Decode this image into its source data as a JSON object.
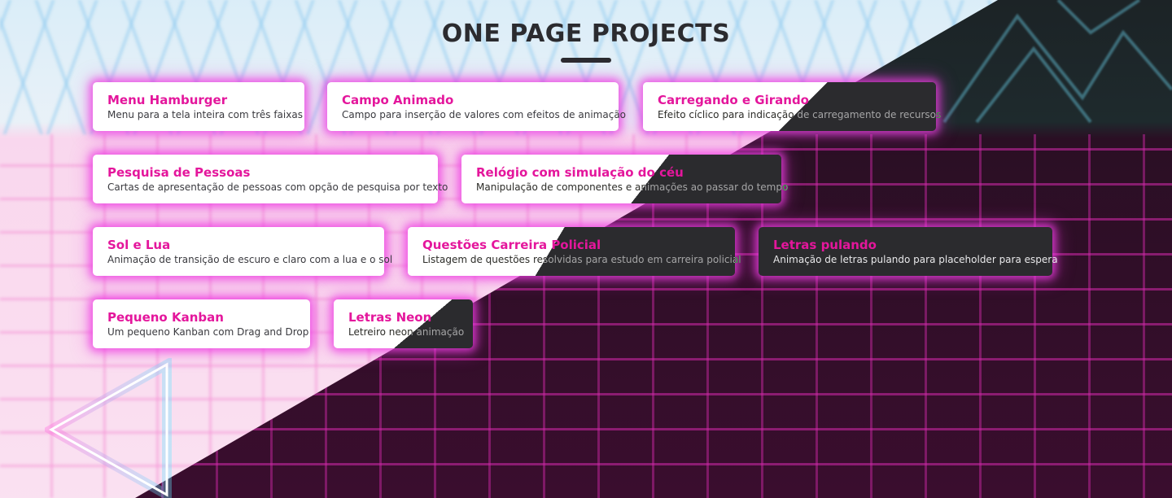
{
  "page": {
    "title": "ONE PAGE PROJECTS"
  },
  "colors": {
    "accent": "#e4169c",
    "glow": "#ee3ce1",
    "dark_card": "#2b2b2e",
    "light_card": "#ffffff",
    "title_text": "#2b2b2f"
  },
  "projects": [
    {
      "title": "Menu Hamburger",
      "description": "Menu para a tela inteira com três faixas"
    },
    {
      "title": "Campo Animado",
      "description": "Campo para inserção de valores com efeitos de animação"
    },
    {
      "title": "Carregando e Girando",
      "description": "Efeito cíclico para indicação de carregamento de recursos"
    },
    {
      "title": "Pesquisa de Pessoas",
      "description": "Cartas de apresentação de pessoas com opção de pesquisa por texto"
    },
    {
      "title": "Relógio com simulação do céu",
      "description": "Manipulação de componentes e animações ao passar do tempo"
    },
    {
      "title": "Sol e Lua",
      "description": "Animação de transição de escuro e claro com a lua e o sol"
    },
    {
      "title": "Questões Carreira Policial",
      "description": "Listagem de questões resolvidas para estudo em carreira policial"
    },
    {
      "title": "Letras pulando",
      "description": "Animação de letras pulando para placeholder para espera"
    },
    {
      "title": "Pequeno Kanban",
      "description": "Um pequeno Kanban com Drag and Drop"
    },
    {
      "title": "Letras Neon",
      "description": "Letreiro neon animação"
    }
  ]
}
